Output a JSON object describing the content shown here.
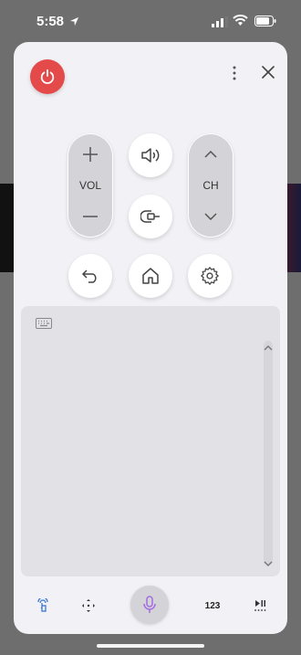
{
  "status_bar": {
    "time": "5:58"
  },
  "remote": {
    "volume_label": "VOL",
    "channel_label": "CH",
    "number_pad_label": "123"
  },
  "colors": {
    "power": "#e54a4a",
    "mic_accent": "#a36be0",
    "touchpad": "#e2e2e6",
    "sheet": "#f2f2f6"
  },
  "icons": [
    "location-arrow-icon",
    "signal-icon",
    "wifi-icon",
    "battery-icon",
    "power-icon",
    "more-vertical-icon",
    "close-icon",
    "plus-icon",
    "minus-icon",
    "speaker-icon",
    "chevron-up-icon",
    "chevron-down-icon",
    "input-source-icon",
    "back-icon",
    "home-icon",
    "settings-gear-icon",
    "keyboard-icon",
    "touch-pointer-icon",
    "dpad-icon",
    "microphone-icon",
    "play-pause-icon"
  ]
}
